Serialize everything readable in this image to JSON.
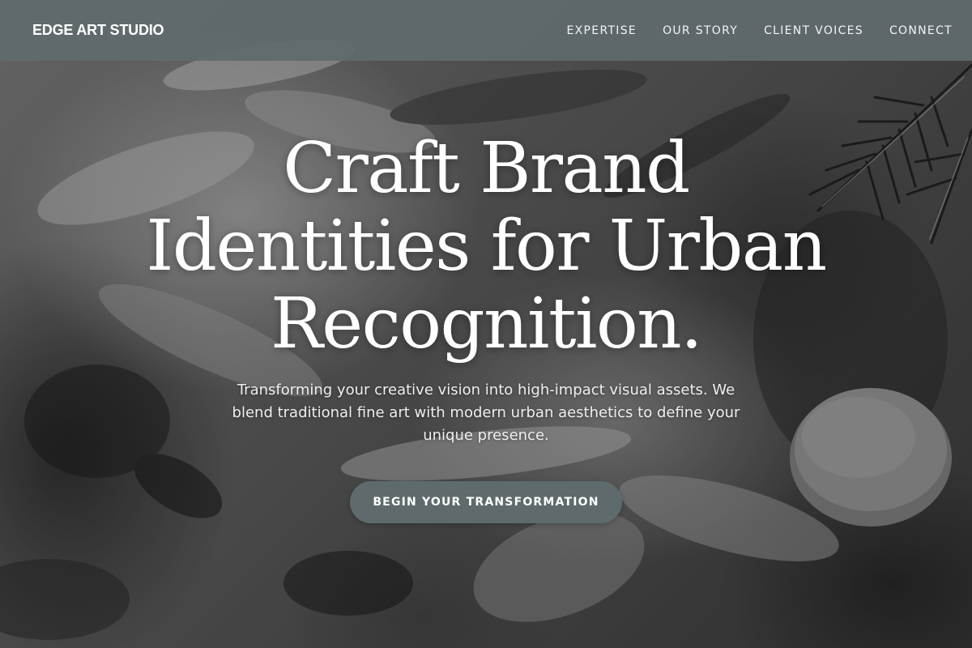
{
  "nav": {
    "brand": "EDGE ART STUDIO",
    "links": [
      {
        "label": "EXPERTISE"
      },
      {
        "label": "OUR STORY"
      },
      {
        "label": "CLIENT VOICES"
      },
      {
        "label": "CONNECT"
      }
    ]
  },
  "hero": {
    "headline_lines": [
      "Craft Brand",
      "Identities for Urban",
      "Recognition."
    ],
    "subtext": "Transforming your creative vision into high-impact visual assets. We blend traditional fine art with modern urban aesthetics to define your unique presence.",
    "cta_label": "BEGIN YOUR TRANSFORMATION",
    "background_image": "grayscale textured oil paint strokes with pine needles",
    "colors": {
      "navbar_bg": "#606a6e",
      "cta_bg": "#5e6a6c",
      "text": "#ffffff"
    }
  }
}
